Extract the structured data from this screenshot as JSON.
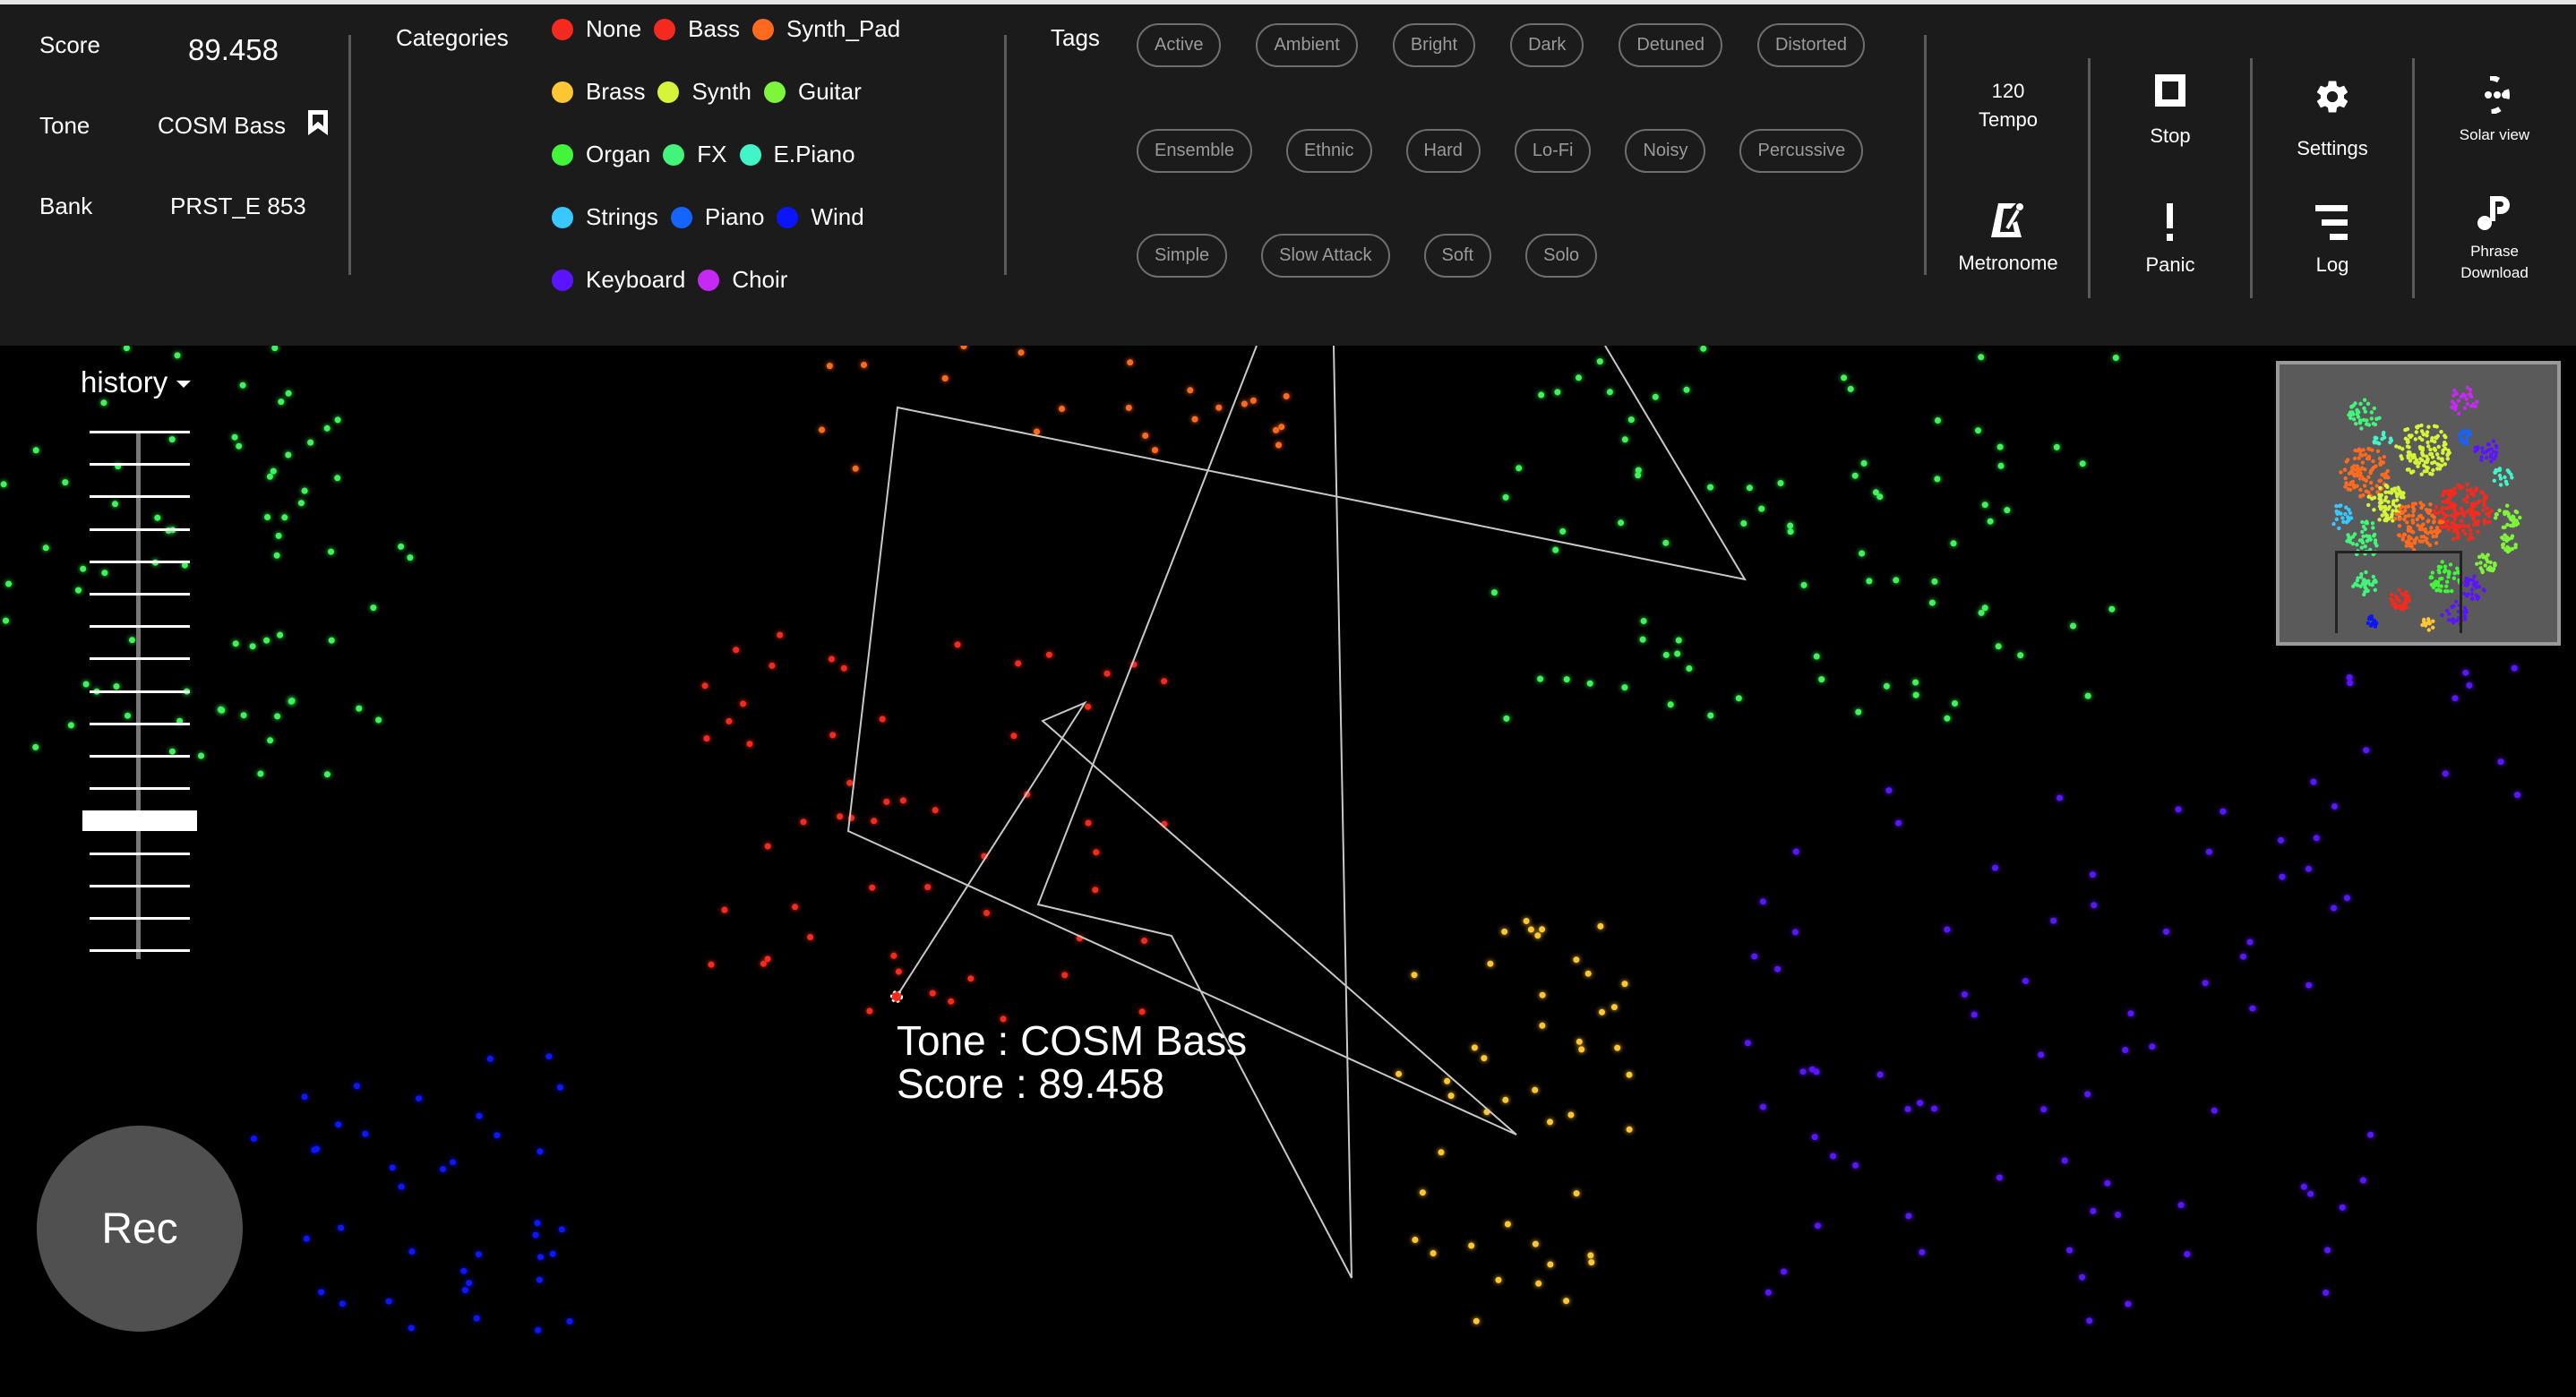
{
  "info": {
    "score_label": "Score",
    "score_value": "89.458",
    "tone_label": "Tone",
    "tone_value": "COSM Bass",
    "bookmark_icon": "bookmark-icon",
    "bank_label": "Bank",
    "bank_value": "PRST_E 853"
  },
  "categories": {
    "title": "Categories",
    "rows": [
      [
        {
          "label": "None",
          "color": "#f52a1f"
        },
        {
          "label": "Bass",
          "color": "#f52a1f"
        },
        {
          "label": "Synth_Pad",
          "color": "#ff6a1f"
        }
      ],
      [
        {
          "label": "Brass",
          "color": "#ffc633"
        },
        {
          "label": "Synth",
          "color": "#d6f53a"
        },
        {
          "label": "Guitar",
          "color": "#7ef53a"
        }
      ],
      [
        {
          "label": "Organ",
          "color": "#42f53a"
        },
        {
          "label": "FX",
          "color": "#42f57a"
        },
        {
          "label": "E.Piano",
          "color": "#42f5c8"
        }
      ],
      [
        {
          "label": "Strings",
          "color": "#38c8ff"
        },
        {
          "label": "Piano",
          "color": "#1464ff"
        },
        {
          "label": "Wind",
          "color": "#0a14ff"
        }
      ],
      [
        {
          "label": "Keyboard",
          "color": "#5a14ff"
        },
        {
          "label": "Choir",
          "color": "#c628f5"
        }
      ]
    ]
  },
  "tags": {
    "title": "Tags",
    "rows": [
      [
        "Active",
        "Ambient",
        "Bright",
        "Dark",
        "Detuned",
        "Distorted"
      ],
      [
        "Ensemble",
        "Ethnic",
        "Hard",
        "Lo-Fi",
        "Noisy",
        "Percussive"
      ],
      [
        "Simple",
        "Slow Attack",
        "Soft",
        "Solo"
      ]
    ]
  },
  "tools": {
    "tempo_value": "120",
    "tempo_label": "Tempo",
    "metronome_label": "Metronome",
    "stop_label": "Stop",
    "panic_label": "Panic",
    "settings_label": "Settings",
    "log_label": "Log",
    "solar_view_label": "Solar view",
    "phrase_download_label_1": "Phrase",
    "phrase_download_label_2": "Download"
  },
  "history": {
    "label": "history",
    "positions": 17,
    "selected_index_from_top": 12
  },
  "rec_label": "Rec",
  "tooltip": {
    "tone_line": "Tone : COSM Bass",
    "score_line": "Score : 89.458"
  },
  "colors": {
    "header_bg": "#1b1b1b",
    "canvas_bg": "#000000",
    "path_line": "#c8c8c8",
    "rec_bg": "#505050",
    "minimap_bg": "#5a5a5a"
  }
}
